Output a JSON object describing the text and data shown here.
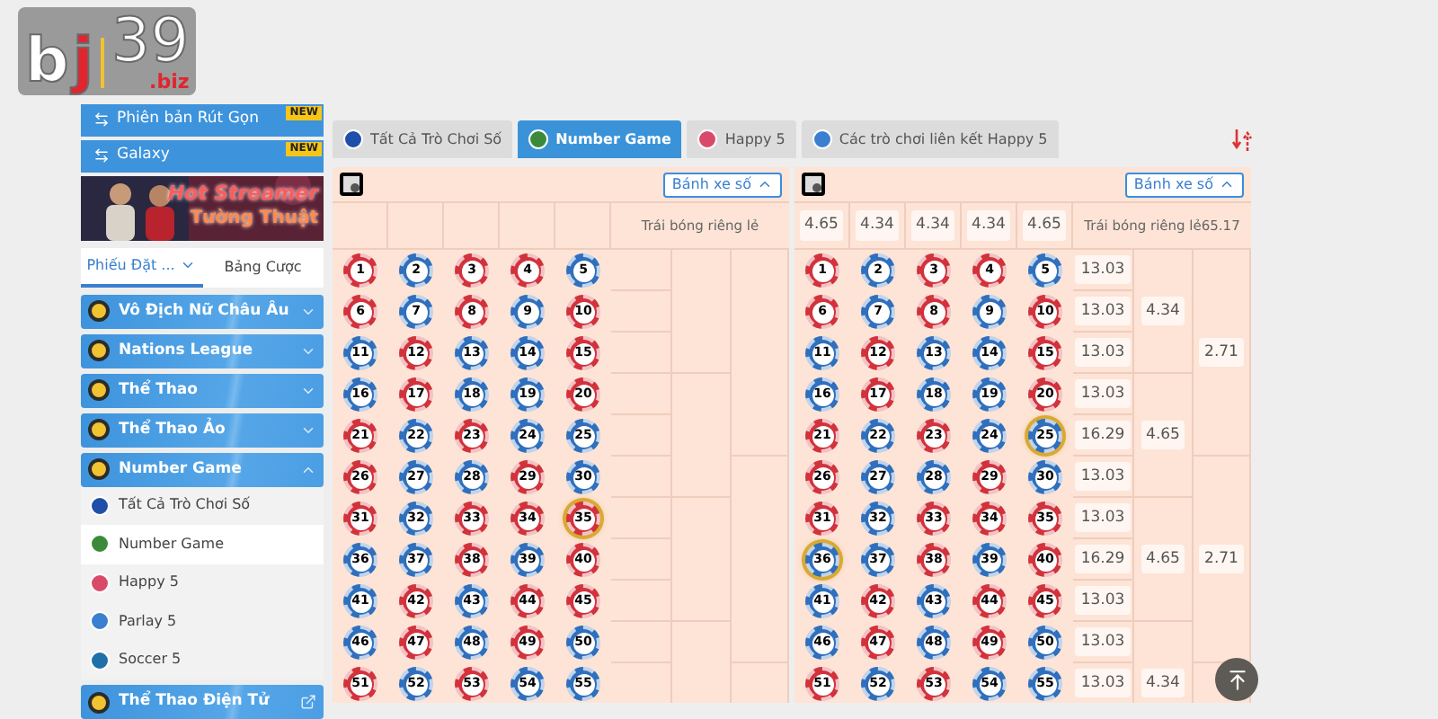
{
  "logo": {
    "letters": [
      {
        "text": "b",
        "color": "#ffffff"
      },
      {
        "text": "j",
        "color": "#e0252f"
      }
    ],
    "number": "39",
    "domain": ".biz"
  },
  "sidebar": {
    "promos": [
      {
        "label": "Phiên bản Rút Gọn",
        "badge": "NEW"
      },
      {
        "label": "Galaxy",
        "badge": "NEW"
      }
    ],
    "banner": {
      "line1": "Hot Streamer",
      "line2": "Tường Thuật"
    },
    "tabs": [
      {
        "label": "Phiếu Đặt ...",
        "selected": true
      },
      {
        "label": "Bảng Cược",
        "selected": false
      }
    ],
    "sections": [
      {
        "label": "Vô Địch Nữ Châu Âu",
        "kind": "accordion",
        "expanded": false
      },
      {
        "label": "Nations League",
        "kind": "accordion",
        "expanded": false
      },
      {
        "label": "Thể Thao",
        "kind": "accordion",
        "expanded": false
      },
      {
        "label": "Thể Thao Ảo",
        "kind": "accordion",
        "expanded": false
      },
      {
        "label": "Number Game",
        "kind": "accordion",
        "expanded": true,
        "children": [
          {
            "label": "Tất Cả Trò Chơi Số",
            "selected": false
          },
          {
            "label": "Number Game",
            "selected": true
          },
          {
            "label": "Happy 5",
            "selected": false
          },
          {
            "label": "Parlay 5",
            "selected": false
          },
          {
            "label": "Soccer 5",
            "selected": false
          }
        ]
      },
      {
        "label": "Thể Thao Điện Tử",
        "kind": "external",
        "expanded": false
      }
    ]
  },
  "tabs": [
    {
      "label": "Tất Cả Trò Chơi Số",
      "selected": false
    },
    {
      "label": "Number Game",
      "selected": true
    },
    {
      "label": "Happy 5",
      "selected": false
    },
    {
      "label": "Các trò chơi liên kết Happy 5",
      "selected": false
    }
  ],
  "panels": [
    {
      "dropdown": "Bánh xe số",
      "group_label": "Trái bóng riêng lẻ",
      "balls": [
        {
          "number": "1",
          "color": "#d2323c",
          "selected": false
        },
        {
          "number": "2",
          "color": "#2f6fbd",
          "selected": false
        },
        {
          "number": "3",
          "color": "#d2323c",
          "selected": false
        },
        {
          "number": "4",
          "color": "#d2323c",
          "selected": false
        },
        {
          "number": "5",
          "color": "#2f6fbd",
          "selected": false
        },
        {
          "number": "6",
          "color": "#d2323c",
          "selected": false
        },
        {
          "number": "7",
          "color": "#2f6fbd",
          "selected": false
        },
        {
          "number": "8",
          "color": "#d2323c",
          "selected": false
        },
        {
          "number": "9",
          "color": "#2f6fbd",
          "selected": false
        },
        {
          "number": "10",
          "color": "#d2323c",
          "selected": false
        },
        {
          "number": "11",
          "color": "#2f6fbd",
          "selected": false
        },
        {
          "number": "12",
          "color": "#d2323c",
          "selected": false
        },
        {
          "number": "13",
          "color": "#2f6fbd",
          "selected": false
        },
        {
          "number": "14",
          "color": "#2f6fbd",
          "selected": false
        },
        {
          "number": "15",
          "color": "#d2323c",
          "selected": false
        },
        {
          "number": "16",
          "color": "#2f6fbd",
          "selected": false
        },
        {
          "number": "17",
          "color": "#d2323c",
          "selected": false
        },
        {
          "number": "18",
          "color": "#2f6fbd",
          "selected": false
        },
        {
          "number": "19",
          "color": "#2f6fbd",
          "selected": false
        },
        {
          "number": "20",
          "color": "#d2323c",
          "selected": false
        },
        {
          "number": "21",
          "color": "#d2323c",
          "selected": false
        },
        {
          "number": "22",
          "color": "#2f6fbd",
          "selected": false
        },
        {
          "number": "23",
          "color": "#d2323c",
          "selected": false
        },
        {
          "number": "24",
          "color": "#2f6fbd",
          "selected": false
        },
        {
          "number": "25",
          "color": "#2f6fbd",
          "selected": false
        },
        {
          "number": "26",
          "color": "#d2323c",
          "selected": false
        },
        {
          "number": "27",
          "color": "#2f6fbd",
          "selected": false
        },
        {
          "number": "28",
          "color": "#2f6fbd",
          "selected": false
        },
        {
          "number": "29",
          "color": "#d2323c",
          "selected": false
        },
        {
          "number": "30",
          "color": "#2f6fbd",
          "selected": false
        },
        {
          "number": "31",
          "color": "#d2323c",
          "selected": false
        },
        {
          "number": "32",
          "color": "#2f6fbd",
          "selected": false
        },
        {
          "number": "33",
          "color": "#d2323c",
          "selected": false
        },
        {
          "number": "34",
          "color": "#d2323c",
          "selected": false
        },
        {
          "number": "35",
          "color": "#d2323c",
          "selected": true
        },
        {
          "number": "36",
          "color": "#2f6fbd",
          "selected": false
        },
        {
          "number": "37",
          "color": "#2f6fbd",
          "selected": false
        },
        {
          "number": "38",
          "color": "#d2323c",
          "selected": false
        },
        {
          "number": "39",
          "color": "#2f6fbd",
          "selected": false
        },
        {
          "number": "40",
          "color": "#d2323c",
          "selected": false
        },
        {
          "number": "41",
          "color": "#2f6fbd",
          "selected": false
        },
        {
          "number": "42",
          "color": "#d2323c",
          "selected": false
        },
        {
          "number": "43",
          "color": "#2f6fbd",
          "selected": false
        },
        {
          "number": "44",
          "color": "#d2323c",
          "selected": false
        },
        {
          "number": "45",
          "color": "#d2323c",
          "selected": false
        },
        {
          "number": "46",
          "color": "#2f6fbd",
          "selected": false
        },
        {
          "number": "47",
          "color": "#d2323c",
          "selected": false
        },
        {
          "number": "48",
          "color": "#2f6fbd",
          "selected": false
        },
        {
          "number": "49",
          "color": "#d2323c",
          "selected": false
        },
        {
          "number": "50",
          "color": "#2f6fbd",
          "selected": false
        },
        {
          "number": "51",
          "color": "#d2323c",
          "selected": false
        },
        {
          "number": "52",
          "color": "#2f6fbd",
          "selected": false
        },
        {
          "number": "53",
          "color": "#d2323c",
          "selected": false
        },
        {
          "number": "54",
          "color": "#2f6fbd",
          "selected": false
        },
        {
          "number": "55",
          "color": "#2f6fbd",
          "selected": false
        }
      ]
    },
    {
      "dropdown": "Bánh xe số",
      "group_label": "Trái bóng riêng lẻ65.17",
      "headers": [
        "4.65",
        "4.34",
        "4.34",
        "4.34",
        "4.65"
      ],
      "balls": [
        {
          "number": "1",
          "color": "#d2323c",
          "selected": false
        },
        {
          "number": "2",
          "color": "#2f6fbd",
          "selected": false
        },
        {
          "number": "3",
          "color": "#d2323c",
          "selected": false
        },
        {
          "number": "4",
          "color": "#d2323c",
          "selected": false
        },
        {
          "number": "5",
          "color": "#2f6fbd",
          "selected": false
        },
        {
          "number": "6",
          "color": "#d2323c",
          "selected": false
        },
        {
          "number": "7",
          "color": "#2f6fbd",
          "selected": false
        },
        {
          "number": "8",
          "color": "#d2323c",
          "selected": false
        },
        {
          "number": "9",
          "color": "#2f6fbd",
          "selected": false
        },
        {
          "number": "10",
          "color": "#d2323c",
          "selected": false
        },
        {
          "number": "11",
          "color": "#2f6fbd",
          "selected": false
        },
        {
          "number": "12",
          "color": "#d2323c",
          "selected": false
        },
        {
          "number": "13",
          "color": "#2f6fbd",
          "selected": false
        },
        {
          "number": "14",
          "color": "#2f6fbd",
          "selected": false
        },
        {
          "number": "15",
          "color": "#d2323c",
          "selected": false
        },
        {
          "number": "16",
          "color": "#2f6fbd",
          "selected": false
        },
        {
          "number": "17",
          "color": "#d2323c",
          "selected": false
        },
        {
          "number": "18",
          "color": "#2f6fbd",
          "selected": false
        },
        {
          "number": "19",
          "color": "#2f6fbd",
          "selected": false
        },
        {
          "number": "20",
          "color": "#d2323c",
          "selected": false
        },
        {
          "number": "21",
          "color": "#d2323c",
          "selected": false
        },
        {
          "number": "22",
          "color": "#2f6fbd",
          "selected": false
        },
        {
          "number": "23",
          "color": "#d2323c",
          "selected": false
        },
        {
          "number": "24",
          "color": "#2f6fbd",
          "selected": false
        },
        {
          "number": "25",
          "color": "#2f6fbd",
          "selected": true
        },
        {
          "number": "26",
          "color": "#d2323c",
          "selected": false
        },
        {
          "number": "27",
          "color": "#2f6fbd",
          "selected": false
        },
        {
          "number": "28",
          "color": "#2f6fbd",
          "selected": false
        },
        {
          "number": "29",
          "color": "#d2323c",
          "selected": false
        },
        {
          "number": "30",
          "color": "#2f6fbd",
          "selected": false
        },
        {
          "number": "31",
          "color": "#d2323c",
          "selected": false
        },
        {
          "number": "32",
          "color": "#2f6fbd",
          "selected": false
        },
        {
          "number": "33",
          "color": "#d2323c",
          "selected": false
        },
        {
          "number": "34",
          "color": "#d2323c",
          "selected": false
        },
        {
          "number": "35",
          "color": "#d2323c",
          "selected": false
        },
        {
          "number": "36",
          "color": "#2f6fbd",
          "selected": true
        },
        {
          "number": "37",
          "color": "#2f6fbd",
          "selected": false
        },
        {
          "number": "38",
          "color": "#d2323c",
          "selected": false
        },
        {
          "number": "39",
          "color": "#2f6fbd",
          "selected": false
        },
        {
          "number": "40",
          "color": "#d2323c",
          "selected": false
        },
        {
          "number": "41",
          "color": "#2f6fbd",
          "selected": false
        },
        {
          "number": "42",
          "color": "#d2323c",
          "selected": false
        },
        {
          "number": "43",
          "color": "#2f6fbd",
          "selected": false
        },
        {
          "number": "44",
          "color": "#d2323c",
          "selected": false
        },
        {
          "number": "45",
          "color": "#d2323c",
          "selected": false
        },
        {
          "number": "46",
          "color": "#2f6fbd",
          "selected": false
        },
        {
          "number": "47",
          "color": "#d2323c",
          "selected": false
        },
        {
          "number": "48",
          "color": "#2f6fbd",
          "selected": false
        },
        {
          "number": "49",
          "color": "#d2323c",
          "selected": false
        },
        {
          "number": "50",
          "color": "#2f6fbd",
          "selected": false
        },
        {
          "number": "51",
          "color": "#d2323c",
          "selected": false
        },
        {
          "number": "52",
          "color": "#2f6fbd",
          "selected": false
        },
        {
          "number": "53",
          "color": "#d2323c",
          "selected": false
        },
        {
          "number": "54",
          "color": "#2f6fbd",
          "selected": false
        },
        {
          "number": "55",
          "color": "#2f6fbd",
          "selected": false
        }
      ],
      "single_odds": [
        "13.03",
        "13.03",
        "13.03",
        "13.03",
        "16.29",
        "13.03",
        "13.03",
        "16.29",
        "13.03",
        "13.03",
        "13.03"
      ],
      "triple_odds": [
        "4.34",
        "4.65",
        "4.65",
        "4.34"
      ],
      "five_odds": [
        "2.71",
        "2.71"
      ]
    }
  ]
}
